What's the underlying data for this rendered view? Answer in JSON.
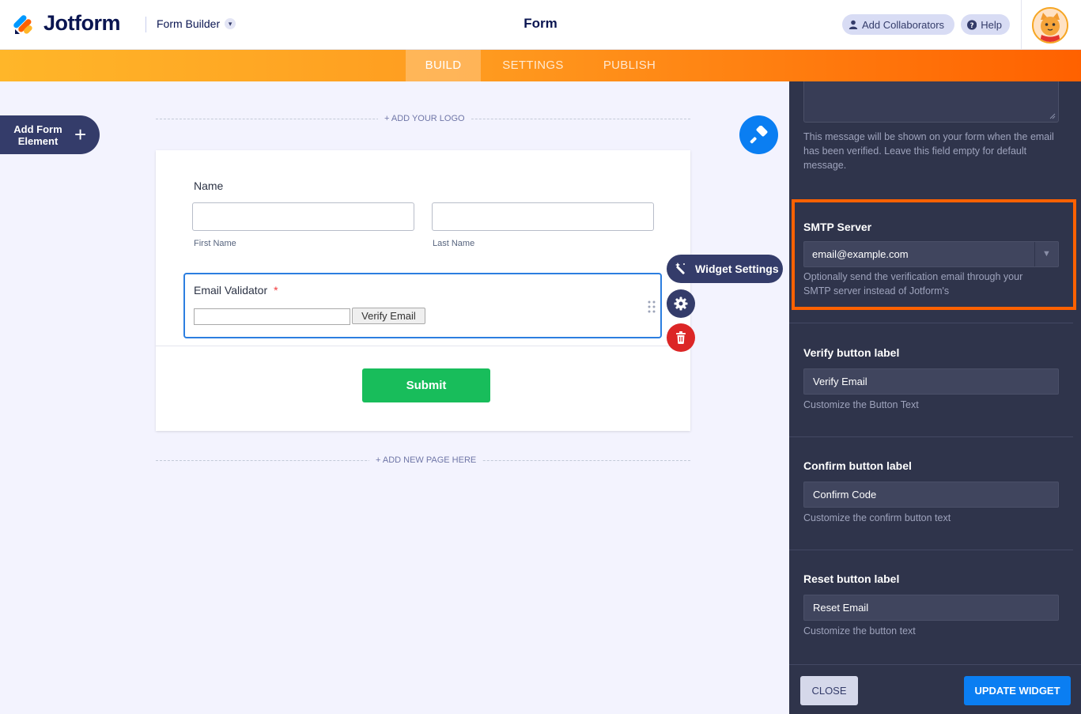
{
  "header": {
    "brand": "Jotform",
    "builder_label": "Form Builder",
    "form_title": "Form",
    "add_collaborators": "Add Collaborators",
    "help": "Help"
  },
  "nav": {
    "tabs": [
      {
        "label": "BUILD",
        "active": true
      },
      {
        "label": "SETTINGS",
        "active": false
      },
      {
        "label": "PUBLISH",
        "active": false
      }
    ]
  },
  "left": {
    "add_element_label": "Add Form Element"
  },
  "canvas": {
    "add_logo": "+ ADD YOUR LOGO",
    "add_page": "+ ADD NEW PAGE HERE"
  },
  "form": {
    "name_label": "Name",
    "first_name_sublabel": "First Name",
    "last_name_sublabel": "Last Name",
    "email_label": "Email Validator",
    "required_mark": "*",
    "verify_button": "Verify Email",
    "submit": "Submit"
  },
  "floating": {
    "widget_settings": "Widget Settings"
  },
  "panel": {
    "verified_message_help": "This message will be shown on your form when the email has been verified. Leave this field empty for default message.",
    "smtp_title": "SMTP Server",
    "smtp_value": "email@example.com",
    "smtp_help": "Optionally send the verification email through your SMTP server instead of Jotform's",
    "verify_title": "Verify button label",
    "verify_value": "Verify Email",
    "verify_help": "Customize the Button Text",
    "confirm_title": "Confirm button label",
    "confirm_value": "Confirm Code",
    "confirm_help": "Customize the confirm button text",
    "reset_title": "Reset button label",
    "reset_value": "Reset Email",
    "reset_help": "Customize the button text",
    "close": "CLOSE",
    "update": "UPDATE WIDGET"
  },
  "colors": {
    "accent_orange": "#ff6100",
    "primary_blue": "#0a7ef2",
    "submit_green": "#18bd5b",
    "panel_bg": "#2f344b",
    "danger_red": "#dc2626"
  }
}
